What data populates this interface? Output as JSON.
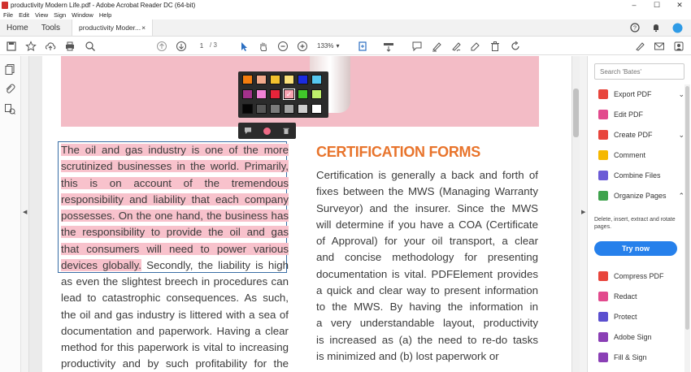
{
  "window": {
    "title": "productivity Modern Life.pdf - Adobe Acrobat Reader DC (64-bit)",
    "controls": [
      "–",
      "☐",
      "✕"
    ]
  },
  "menu": [
    "File",
    "Edit",
    "View",
    "Sign",
    "Window",
    "Help"
  ],
  "tabs": {
    "home": "Home",
    "tools": "Tools",
    "doc": "productivity Moder...",
    "doc_close": "×"
  },
  "toolbar": {
    "page_current": "1",
    "page_total": "/ 3",
    "zoom": "133%"
  },
  "palette": {
    "colors": [
      "#f47d0f",
      "#f2aa8c",
      "#f2c12e",
      "#f9e07a",
      "#1b2be0",
      "#56c7ef",
      "#a3318b",
      "#f081d6",
      "#e8243a",
      "#f7a3b1",
      "#40c62a",
      "#bff06b",
      "#050505",
      "#575757",
      "#7c7c7c",
      "#a3a3a3",
      "#cfcfcf",
      "#ffffff"
    ],
    "selected_index": 9,
    "check": "✓"
  },
  "left_column": {
    "highlighted_lines": [
      "The oil and gas industry is one of the more",
      "scrutinized businesses in the world. Primarily,",
      "this is on account of the tremendous",
      "responsibility and liability that each company",
      "possesses. On the one hand, the business has",
      "the responsibility to provide the oil and gas",
      "that consumers will need to power various"
    ],
    "mixed_line_highlight": "devices globally.",
    "mixed_line_rest": "Secondly, the liability is high",
    "lines": [
      "as even the slightest breech in procedures can",
      "lead to catastrophic consequences. As such,",
      "the oil and gas industry is littered with a sea of",
      "documentation and paperwork. Having a clear",
      "method for this paperwork is vital to increasing",
      "productivity and by such profitability for the"
    ]
  },
  "right_column": {
    "heading": "CERTIFICATION FORMS",
    "lines": [
      "Certification is generally a back and forth of",
      "fixes between the MWS (Managing Warranty",
      "Surveyor) and the insurer. Since the MWS",
      "will determine if you have a COA (Certificate",
      "of Approval) for your oil transport, a clear",
      "and concise methodology for presenting",
      "documentation is vital. PDFElement provides",
      "a quick and clear way to present information",
      "to the MWS. By having the information in",
      "a very understandable layout, productivity",
      "is increased as (a) the need to re-do tasks",
      "is minimized and (b) lost paperwork or"
    ]
  },
  "right_panel": {
    "search_placeholder": "Search 'Bates'",
    "tools_top": [
      {
        "label": "Export PDF",
        "color": "#e8453c",
        "chev": "⌄"
      },
      {
        "label": "Edit PDF",
        "color": "#e24a8d",
        "chev": ""
      },
      {
        "label": "Create PDF",
        "color": "#e8453c",
        "chev": "⌄"
      },
      {
        "label": "Comment",
        "color": "#f5b800",
        "chev": ""
      },
      {
        "label": "Combine Files",
        "color": "#6b5bd6",
        "chev": ""
      },
      {
        "label": "Organize Pages",
        "color": "#3fa34d",
        "chev": "⌃"
      }
    ],
    "organize_desc": "Delete, insert, extract and rotate pages.",
    "try_now": "Try now",
    "tools_bottom": [
      {
        "label": "Compress PDF",
        "color": "#e8453c"
      },
      {
        "label": "Redact",
        "color": "#e24a8d"
      },
      {
        "label": "Protect",
        "color": "#5b4fcf"
      },
      {
        "label": "Adobe Sign",
        "color": "#8a3fb5"
      },
      {
        "label": "Fill & Sign",
        "color": "#8a3fb5"
      }
    ]
  }
}
